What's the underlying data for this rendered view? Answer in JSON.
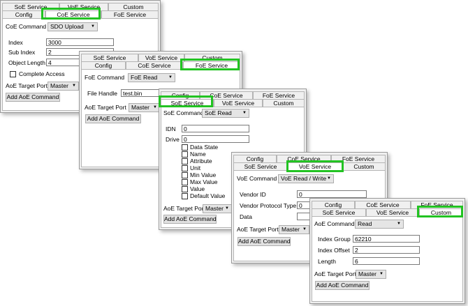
{
  "labels": {
    "soe_service": "SoE Service",
    "voe_service": "VoE Service",
    "custom": "Custom",
    "config": "Config",
    "coe_service": "CoE Service",
    "foe_service": "FoE Service",
    "aoe_target_port": "AoE Target Port",
    "add_aoe_command": "Add AoE Command",
    "master": "Master"
  },
  "coe": {
    "command_label": "CoE Command",
    "command_value": "SDO Upload",
    "index_label": "Index",
    "index_value": "3000",
    "subindex_label": "Sub Index",
    "subindex_value": "2",
    "objlen_label": "Object Length",
    "objlen_value": "4",
    "complete_access": "Complete Access"
  },
  "foe": {
    "command_label": "FoE Command",
    "command_value": "FoE Read",
    "file_handle_label": "File Handle",
    "file_handle_value": "test.bin"
  },
  "soe": {
    "command_label": "SoE Command",
    "command_value": "SoE Read",
    "idn_label": "IDN",
    "idn_value": "0",
    "drive_label": "Drive",
    "drive_value": "0",
    "elements": [
      "Data State",
      "Name",
      "Attribute",
      "Unit",
      "Min Value",
      "Max Value",
      "Value",
      "Default Value"
    ]
  },
  "voe": {
    "command_label": "VoE Command",
    "command_value": "VoE Read / Write",
    "vendor_id_label": "Vendor ID",
    "vendor_id_value": "0",
    "vendor_protocol_label": "Vendor Protocol Type",
    "vendor_protocol_value": "0",
    "data_label": "Data"
  },
  "custom": {
    "command_label": "AoE Command",
    "command_value": "Read",
    "index_group_label": "Index Group",
    "index_group_value": "62210",
    "index_offset_label": "Index Offset",
    "index_offset_value": "2",
    "length_label": "Length",
    "length_value": "6"
  }
}
